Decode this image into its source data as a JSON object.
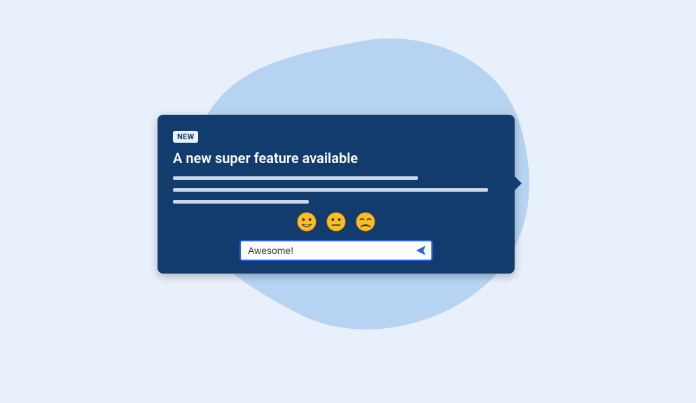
{
  "card": {
    "badge": "NEW",
    "title": "A new super feature available",
    "input_value": "Awesome!",
    "input_placeholder": "Awesome!"
  },
  "emojis": {
    "happy": "happy-face",
    "neutral": "neutral-face",
    "sad": "sad-face"
  },
  "colors": {
    "background": "#e7f0fb",
    "blob": "#b6d3f2",
    "card": "#123b6e",
    "accent": "#2563eb",
    "emoji_yellow": "#fbbf24"
  }
}
